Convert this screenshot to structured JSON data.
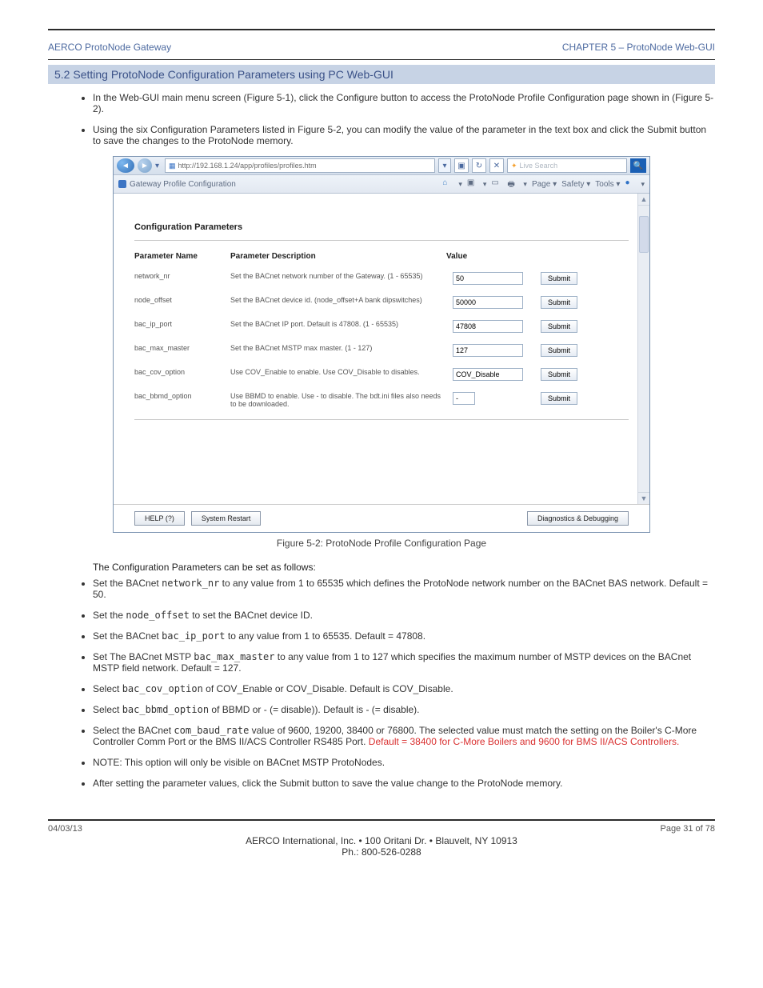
{
  "header": {
    "left": "AERCO ProtoNode Gateway",
    "right": "CHAPTER 5 – ProtoNode Web-GUI"
  },
  "sectionBar": "5.2  Setting ProtoNode Configuration Parameters using PC Web-GUI",
  "topBullets": [
    "In the Web-GUI main menu screen (Figure 5-1), click the Configure button to access the ProtoNode Profile Configuration page shown in (Figure 5-2).",
    "Using the six Configuration Parameters listed in Figure 5-2, you can modify the value of the parameter in the text box and click the Submit button to save the changes to the ProtoNode memory."
  ],
  "browser": {
    "url": "http://192.168.1.24/app/profiles/profiles.htm",
    "searchPlaceholder": "Live Search",
    "tabTitle": "Gateway Profile Configuration",
    "rightMenu": [
      "Page",
      "Safety",
      "Tools"
    ]
  },
  "config": {
    "title": "Configuration Parameters",
    "headers": {
      "name": "Parameter Name",
      "desc": "Parameter Description",
      "value": "Value"
    },
    "rows": [
      {
        "name": "network_nr",
        "desc": "Set the BACnet network number of the Gateway. (1 - 65535)",
        "value": "50"
      },
      {
        "name": "node_offset",
        "desc": "Set the BACnet device id. (node_offset+A bank dipswitches)",
        "value": "50000"
      },
      {
        "name": "bac_ip_port",
        "desc": "Set the BACnet IP port. Default is 47808. (1 - 65535)",
        "value": "47808"
      },
      {
        "name": "bac_max_master",
        "desc": "Set the BACnet MSTP max master. (1 - 127)",
        "value": "127"
      },
      {
        "name": "bac_cov_option",
        "desc": "Use COV_Enable to enable. Use COV_Disable to disables.",
        "value": "COV_Disable"
      },
      {
        "name": "bac_bbmd_option",
        "desc": "Use BBMD to enable. Use - to disable. The bdt.ini files also needs to be downloaded.",
        "value": "-"
      }
    ],
    "submitLabel": "Submit",
    "bottomButtons": {
      "help": "HELP (?)",
      "restart": "System Restart",
      "diag": "Diagnostics & Debugging"
    }
  },
  "figCaption": "Figure 5-2:  ProtoNode Profile Configuration Page",
  "postFigIntro": "The Configuration Parameters can be set as follows:",
  "settings": [
    {
      "textBefore": "Set the BACnet ",
      "code": "network_nr",
      "textAfter": " to any value from 1 to 65535 which defines the ProtoNode network number on the BACnet BAS network. Default = 50."
    },
    {
      "textBefore": "Set the ",
      "code": "node_offset",
      "textAfter": " to set the BACnet device ID."
    },
    {
      "textBefore": "Set the BACnet ",
      "code": "bac_ip_port",
      "textAfter": " to any value from 1 to 65535. Default = 47808."
    },
    {
      "textBefore": "Set The BACnet MSTP ",
      "code": "bac_max_master",
      "textAfter": " to any value from 1 to 127 which specifies the maximum number of MSTP devices on the BACnet MSTP field network. Default = 127."
    },
    {
      "textBefore": "Select ",
      "code": "bac_cov_option",
      "textAfter": " of COV_Enable or COV_Disable.  Default is COV_Disable."
    },
    {
      "textBefore": "Select ",
      "code": "bac_bbmd_option",
      "textAfter": " of BBMD or - (= disable)). Default is - (= disable)."
    },
    {
      "textBefore": "Select the BACnet ",
      "code": "com_baud_rate",
      "textAfter": " value of 9600, 19200, 38400 or 76800. The selected value must match the setting on the Boiler's C-More Controller Comm Port or the BMS II/ACS Controller RS485 Port. ",
      "redNote": "Default = 38400 for C-More Boilers and 9600 for BMS II/ACS Controllers."
    },
    {
      "textBefore": "NOTE: This option will only be visible on BACnet MSTP ProtoNodes.",
      "code": "",
      "textAfter": ""
    },
    {
      "textBefore": "After setting the parameter values, click the Submit button to save the value change to the ProtoNode memory.",
      "code": "",
      "textAfter": ""
    }
  ],
  "footer": {
    "leftMeta": "04/03/13",
    "rightMeta": "Page 31 of 78",
    "addr1": "AERCO International, Inc. • 100 Oritani Dr. • Blauvelt, NY 10913",
    "addr2": "Ph.: 800-526-0288"
  }
}
